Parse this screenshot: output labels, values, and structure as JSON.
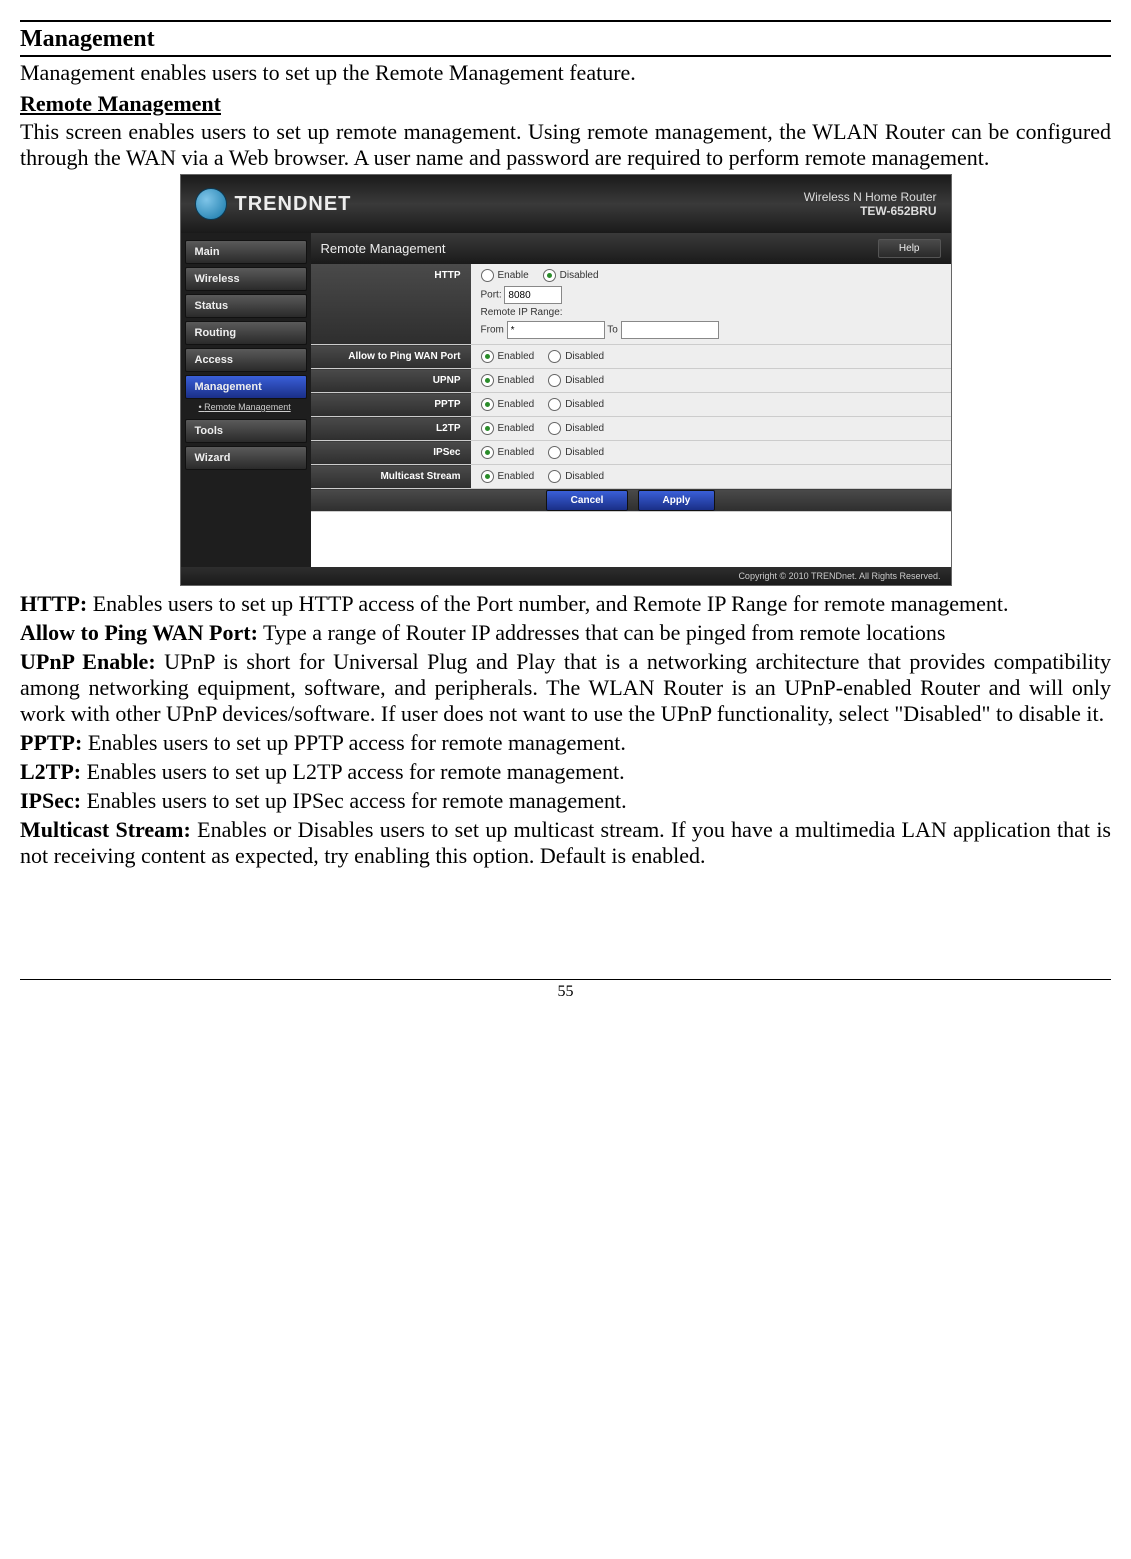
{
  "heading": "Management",
  "intro": "Management enables users to set up the Remote Management feature.",
  "subheading": "Remote Management",
  "sub_intro": "This screen enables users to set up remote management. Using remote management, the WLAN Router can be configured through the WAN via a Web browser. A user name and password are required to perform remote management.",
  "screenshot": {
    "brand": "TRENDNET",
    "product_line": "Wireless N Home Router",
    "model": "TEW-652BRU",
    "nav": {
      "main": "Main",
      "wireless": "Wireless",
      "status": "Status",
      "routing": "Routing",
      "access": "Access",
      "management": "Management",
      "management_sub": "Remote Management",
      "tools": "Tools",
      "wizard": "Wizard"
    },
    "panel_title": "Remote Management",
    "help": "Help",
    "rows": {
      "http": {
        "label": "HTTP",
        "enable": "Enable",
        "disabled": "Disabled",
        "port_label": "Port:",
        "port_value": "8080",
        "remote_ip_label": "Remote IP Range:",
        "from_label": "From",
        "from_value": "*",
        "to_label": "To",
        "to_value": ""
      },
      "ping": {
        "label": "Allow to Ping WAN Port",
        "enabled": "Enabled",
        "disabled": "Disabled"
      },
      "upnp": {
        "label": "UPNP",
        "enabled": "Enabled",
        "disabled": "Disabled"
      },
      "pptp": {
        "label": "PPTP",
        "enabled": "Enabled",
        "disabled": "Disabled"
      },
      "l2tp": {
        "label": "L2TP",
        "enabled": "Enabled",
        "disabled": "Disabled"
      },
      "ipsec": {
        "label": "IPSec",
        "enabled": "Enabled",
        "disabled": "Disabled"
      },
      "multicast": {
        "label": "Multicast Stream",
        "enabled": "Enabled",
        "disabled": "Disabled"
      }
    },
    "cancel": "Cancel",
    "apply": "Apply",
    "copyright": "Copyright © 2010 TRENDnet. All Rights Reserved."
  },
  "defs": {
    "http_term": "HTTP:",
    "http_body": " Enables users to set up HTTP access of the Port number, and Remote IP Range for remote management.",
    "ping_term": "Allow to Ping WAN Port:",
    "ping_body": " Type a range of Router IP addresses that can be pinged from remote locations",
    "upnp_term": "UPnP Enable:",
    "upnp_body": " UPnP is short for Universal Plug and Play that is a networking architecture that provides compatibility among networking equipment, software, and peripherals. The WLAN Router is an UPnP-enabled Router and will only work with other UPnP devices/software. If user does not want to use the UPnP functionality, select \"Disabled\" to disable it.",
    "pptp_term": "PPTP:",
    "pptp_body": " Enables users to set up PPTP access for remote management.",
    "l2tp_term": "L2TP:",
    "l2tp_body": " Enables users to set up L2TP access for remote management.",
    "ipsec_term": "IPSec:",
    "ipsec_body": " Enables users to set up IPSec access for remote management.",
    "multicast_term": "Multicast Stream:",
    "multicast_body": " Enables or Disables users to set up multicast stream. If you have a multimedia LAN application that is not receiving content as expected, try enabling this option. Default is enabled."
  },
  "page_number": "55"
}
